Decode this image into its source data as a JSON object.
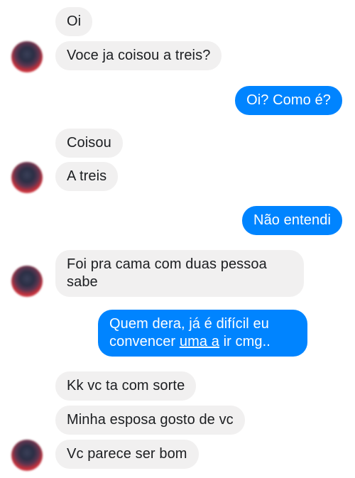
{
  "messages": [
    {
      "side": "in",
      "text": "Oi"
    },
    {
      "side": "in",
      "text": "Voce ja coisou a treis?"
    },
    {
      "side": "out",
      "text": "Oi? Como é?"
    },
    {
      "side": "in",
      "text": "Coisou"
    },
    {
      "side": "in",
      "text": "A treis"
    },
    {
      "side": "out",
      "text": "Não entendi"
    },
    {
      "side": "in",
      "line1": "Foi pra cama com duas pessoa",
      "line2": "sabe"
    },
    {
      "side": "out",
      "line1": "Quem dera, já é difícil eu",
      "line2_pre": "convencer ",
      "line2_link": "uma a",
      "line2_post": " ir cmg.."
    },
    {
      "side": "in",
      "text": "Kk vc ta com sorte"
    },
    {
      "side": "in",
      "text": "Minha esposa gosto de vc"
    },
    {
      "side": "in",
      "text": "Vc parece ser bom"
    }
  ],
  "colors": {
    "incoming_bubble": "#f1f0f0",
    "outgoing_bubble": "#0084ff",
    "incoming_text": "#1c1e21",
    "outgoing_text": "#ffffff"
  }
}
